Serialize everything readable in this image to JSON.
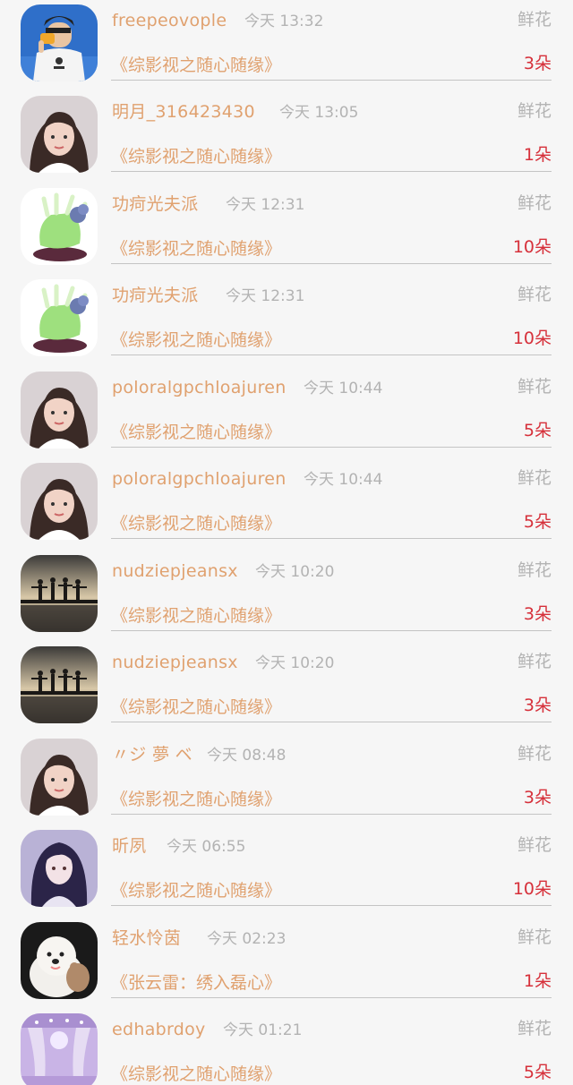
{
  "gift_records": [
    {
      "avatar_icon": "user-avatar-boy-icon",
      "name": "freepeovople",
      "time": "今天 13:32",
      "gift_type": "鲜花",
      "work_title": "《综影视之随心随缘》",
      "count": "3朵"
    },
    {
      "avatar_icon": "user-avatar-girl-icon",
      "name": "明月_316423430",
      "time": "今天 13:05",
      "gift_type": "鲜花",
      "work_title": "《综影视之随心随缘》",
      "count": "1朵"
    },
    {
      "avatar_icon": "user-avatar-figurine-icon",
      "name": "功疴光夫派",
      "time": "今天 12:31",
      "gift_type": "鲜花",
      "work_title": "《综影视之随心随缘》",
      "count": "10朵"
    },
    {
      "avatar_icon": "user-avatar-figurine-icon",
      "name": "功疴光夫派",
      "time": "今天 12:31",
      "gift_type": "鲜花",
      "work_title": "《综影视之随心随缘》",
      "count": "10朵"
    },
    {
      "avatar_icon": "user-avatar-girl-icon",
      "name": "poloralgpchloajuren",
      "time": "今天 10:44",
      "gift_type": "鲜花",
      "work_title": "《综影视之随心随缘》",
      "count": "5朵"
    },
    {
      "avatar_icon": "user-avatar-girl-icon",
      "name": "poloralgpchloajuren",
      "time": "今天 10:44",
      "gift_type": "鲜花",
      "work_title": "《综影视之随心随缘》",
      "count": "5朵"
    },
    {
      "avatar_icon": "user-avatar-sunset-silhouettes-icon",
      "name": "nudziepjeansx",
      "time": "今天 10:20",
      "gift_type": "鲜花",
      "work_title": "《综影视之随心随缘》",
      "count": "3朵"
    },
    {
      "avatar_icon": "user-avatar-sunset-silhouettes-icon",
      "name": "nudziepjeansx",
      "time": "今天 10:20",
      "gift_type": "鲜花",
      "work_title": "《综影视之随心随缘》",
      "count": "3朵"
    },
    {
      "avatar_icon": "user-avatar-girl-icon",
      "name": "〃ジ 夢 ベ",
      "time": "今天 08:48",
      "gift_type": "鲜花",
      "work_title": "《综影视之随心随缘》",
      "count": "3朵"
    },
    {
      "avatar_icon": "user-avatar-anime-girl-icon",
      "name": "昕夙",
      "time": "今天 06:55",
      "gift_type": "鲜花",
      "work_title": "《综影视之随心随缘》",
      "count": "10朵"
    },
    {
      "avatar_icon": "user-avatar-puppy-icon",
      "name": "轻水怜茵",
      "time": "今天 02:23",
      "gift_type": "鲜花",
      "work_title": "《张云雷：绣入磊心》",
      "count": "1朵"
    },
    {
      "avatar_icon": "user-avatar-purple-scene-icon",
      "name": "edhabrdoy",
      "time": "今天 01:21",
      "gift_type": "鲜花",
      "work_title": "《综影视之随心随缘》",
      "count": "5朵"
    }
  ]
}
